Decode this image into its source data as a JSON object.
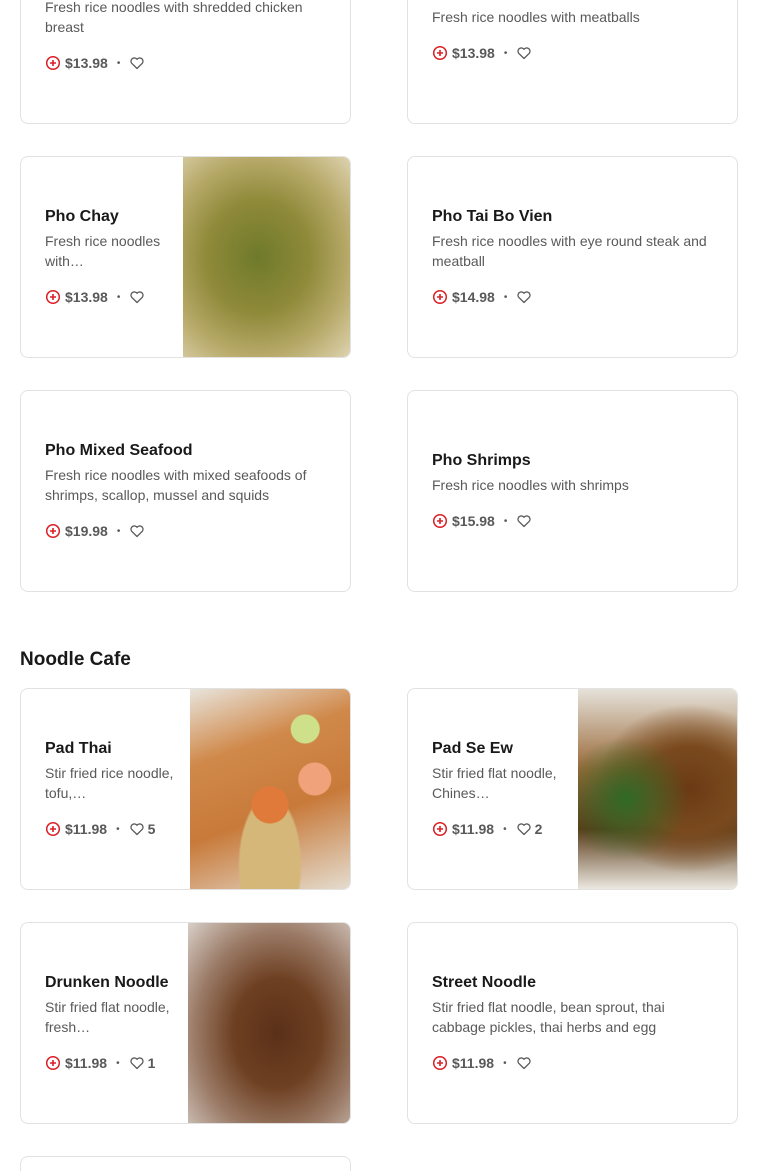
{
  "sections": [
    {
      "title": "Noodle Cafe"
    }
  ],
  "items": {
    "pho_ga": {
      "description": "Fresh rice noodles with shredded chicken breast",
      "price": "$13.98"
    },
    "pho_bo_vien": {
      "description": "Fresh rice noodles with meatballs",
      "price": "$13.98"
    },
    "pho_chay": {
      "name": "Pho Chay",
      "description": "Fresh rice noodles with…",
      "price": "$13.98"
    },
    "pho_tai_bo_vien": {
      "name": "Pho Tai Bo Vien",
      "description": "Fresh rice noodles with eye round steak and meatball",
      "price": "$14.98"
    },
    "pho_mixed_seafood": {
      "name": "Pho Mixed Seafood",
      "description": "Fresh rice noodles with mixed seafoods of shrimps, scallop, mussel and squids",
      "price": "$19.98"
    },
    "pho_shrimps": {
      "name": "Pho Shrimps",
      "description": "Fresh rice noodles with shrimps",
      "price": "$15.98"
    },
    "pad_thai": {
      "name": "Pad Thai",
      "description": "Stir fried rice noodle, tofu,…",
      "price": "$11.98",
      "likes": "5"
    },
    "pad_se_ew": {
      "name": "Pad Se Ew",
      "description": "Stir fried flat noodle, Chines…",
      "price": "$11.98",
      "likes": "2"
    },
    "drunken_noodle": {
      "name": "Drunken Noodle",
      "description": "Stir fried flat noodle, fresh…",
      "price": "$11.98",
      "likes": "1"
    },
    "street_noodle": {
      "name": "Street Noodle",
      "description": "Stir fried flat noodle, bean sprout, thai cabbage pickles, thai herbs and egg",
      "price": "$11.98"
    }
  },
  "separator": "•",
  "colors": {
    "accent": "#d91f26",
    "border": "#e2e2e2",
    "muted": "#595959"
  }
}
